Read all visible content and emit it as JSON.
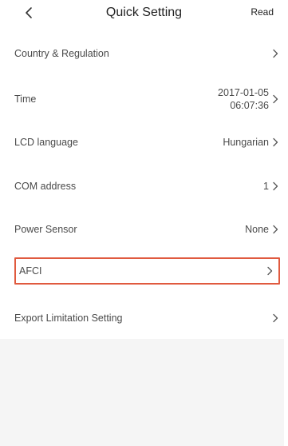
{
  "header": {
    "title": "Quick Setting",
    "read_label": "Read"
  },
  "rows": [
    {
      "label": "Country & Regulation",
      "value": ""
    },
    {
      "label": "Time",
      "value_line1": "2017-01-05",
      "value_line2": "06:07:36"
    },
    {
      "label": "LCD language",
      "value": "Hungarian"
    },
    {
      "label": "COM address",
      "value": "1"
    },
    {
      "label": "Power Sensor",
      "value": "None"
    },
    {
      "label": "AFCI",
      "value": ""
    },
    {
      "label": "Export Limitation Setting",
      "value": ""
    }
  ],
  "colors": {
    "highlight_border": "#e05a3f",
    "empty_area": "#f5f5f5"
  },
  "icons": {
    "back": "chevron-left-icon",
    "row_arrow": "chevron-right-icon"
  }
}
